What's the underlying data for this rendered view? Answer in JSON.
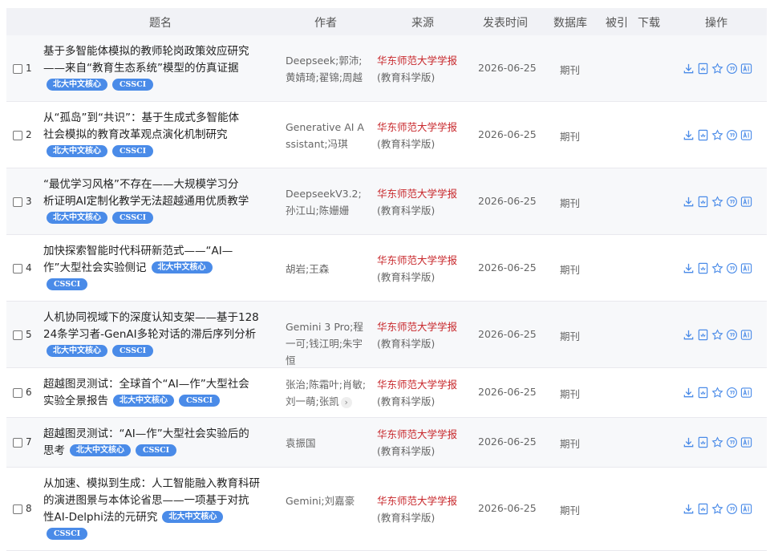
{
  "header": {
    "title": "题名",
    "author": "作者",
    "source": "来源",
    "date": "发表时间",
    "database": "数据库",
    "cited": "被引",
    "downloads": "下载",
    "ops": "操作"
  },
  "colors": {
    "accent": "#4a8be8",
    "source_red": "#c8282c"
  },
  "badges": {
    "pku": "北大中文核心",
    "cssci": "CSSCI"
  },
  "rows": [
    {
      "index": "1",
      "title": "基于多智能体模拟的教师轮岗政策效应研究\n——来自“教育生态系统”模型的仿真证据",
      "authors": "Deepseek;郭沛;黄婧琦;翟锦;周越",
      "source_main": "华东师范大学学报",
      "source_sub": "(教育科学版)",
      "date": "2026-06-25",
      "database": "期刊"
    },
    {
      "index": "2",
      "title": "从“孤岛”到“共识”：基于生成式多智能体\n社会模拟的教育改革观点演化机制研究",
      "authors": "Generative AI Assistant;冯琪",
      "source_main": "华东师范大学学报",
      "source_sub": "(教育科学版)",
      "date": "2026-06-25",
      "database": "期刊"
    },
    {
      "index": "3",
      "title": "“最优学习风格”不存在——大规模学习分\n析证明AI定制化教学无法超越通用优质教学",
      "authors": "DeepseekV3.2;孙江山;陈姗姗",
      "source_main": "华东师范大学学报",
      "source_sub": "(教育科学版)",
      "date": "2026-06-25",
      "database": "期刊"
    },
    {
      "index": "4",
      "title": "加快探索智能时代科研新范式——“AI—\n作”大型社会实验侧记",
      "authors": "胡岩;王森",
      "source_main": "华东师范大学学报",
      "source_sub": "(教育科学版)",
      "date": "2026-06-25",
      "database": "期刊"
    },
    {
      "index": "5",
      "title": "人机协同视域下的深度认知支架——基于128\n24条学习者-GenAI多轮对话的滞后序列分析",
      "authors": "Gemini 3 Pro;程一可;钱江明;朱宇恒",
      "source_main": "华东师范大学学报",
      "source_sub": "(教育科学版)",
      "date": "2026-06-25",
      "database": "期刊"
    },
    {
      "index": "6",
      "title": "超越图灵测试：全球首个“AI—作”大型社会\n实验全景报告",
      "authors": "张治;陈霜叶;肖敏;刘一萌;张凯",
      "source_main": "华东师范大学学报",
      "source_sub": "(教育科学版)",
      "date": "2026-06-25",
      "database": "期刊"
    },
    {
      "index": "7",
      "title": "超越图灵测试：“AI—作”大型社会实验后的\n思考",
      "authors": "袁振国",
      "source_main": "华东师范大学学报",
      "source_sub": "(教育科学版)",
      "date": "2026-06-25",
      "database": "期刊"
    },
    {
      "index": "8",
      "title": "从加速、模拟到生成：人工智能融入教育科研\n的演进图景与本体论省思——一项基于对抗\n性AI-Delphi法的元研究",
      "authors": "Gemini;刘嘉豪",
      "source_main": "华东师范大学学报",
      "source_sub": "(教育科学版)",
      "date": "2026-06-25",
      "database": "期刊"
    }
  ],
  "icons": [
    "download-icon",
    "html-read-icon",
    "favorite-star-icon",
    "cite-icon",
    "ai-icon"
  ]
}
